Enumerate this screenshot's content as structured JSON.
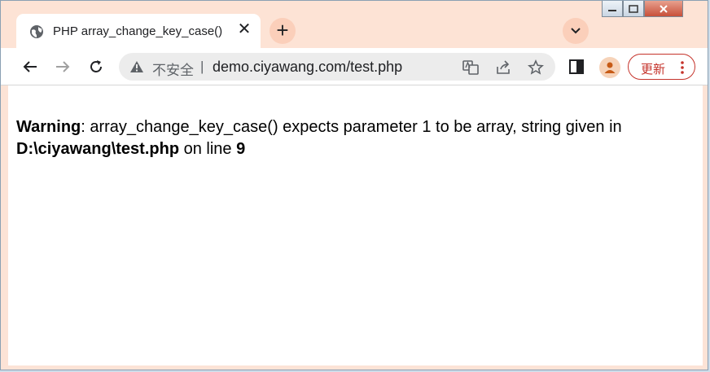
{
  "tab": {
    "title": "PHP array_change_key_case()",
    "icon": "globe-icon",
    "close_glyph": "✕"
  },
  "new_tab_glyph": "+",
  "omnibox": {
    "security_label": "不安全",
    "separator": "|",
    "url": "demo.ciyawang.com/test.php"
  },
  "update_button": {
    "label": "更新"
  },
  "colors": {
    "tabstrip": "#fde3d5",
    "update_accent": "#c5332b",
    "avatar": "#f6d3b9"
  },
  "page": {
    "warning_label": "Warning",
    "warning_text": ": array_change_key_case() expects parameter 1 to be array, string given in ",
    "file_path": "D:\\ciyawang\\test.php",
    "on_line_text": " on line ",
    "line_number": "9"
  }
}
